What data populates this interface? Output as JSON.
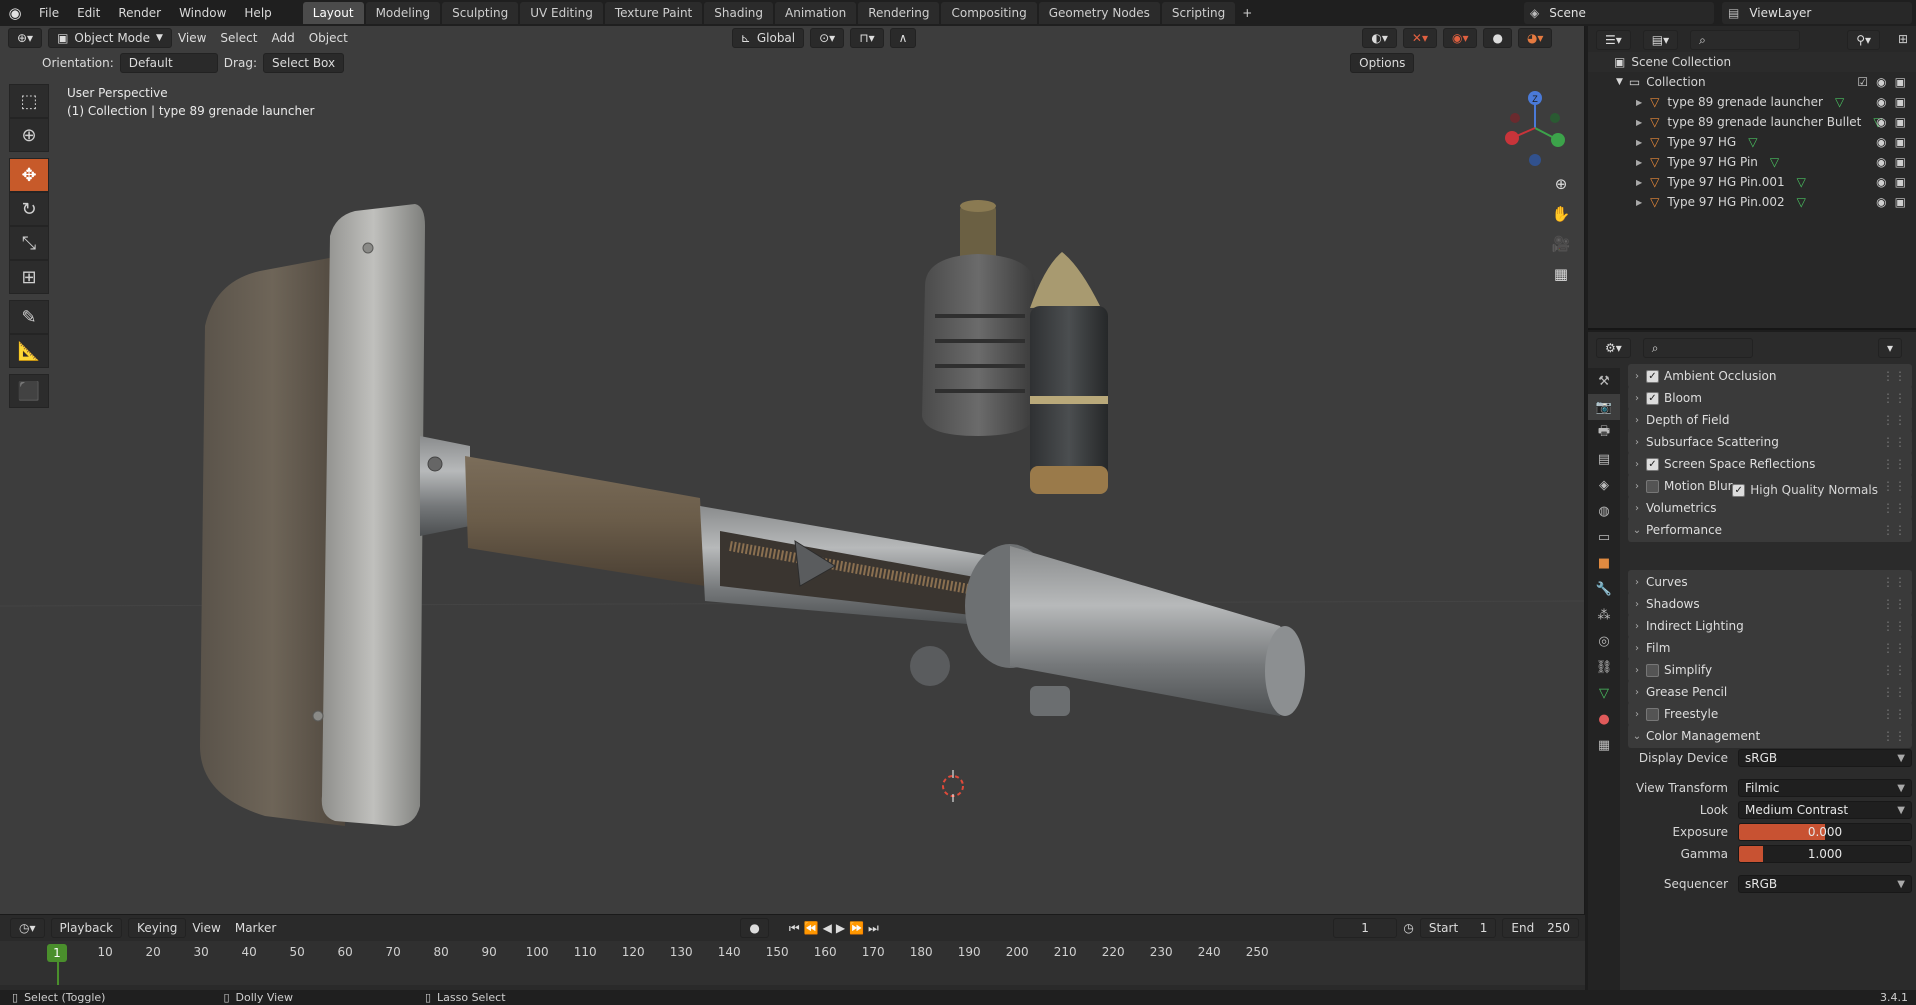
{
  "topbar": {
    "menus": [
      "File",
      "Edit",
      "Render",
      "Window",
      "Help"
    ],
    "workspaces": [
      "Layout",
      "Modeling",
      "Sculpting",
      "UV Editing",
      "Texture Paint",
      "Shading",
      "Animation",
      "Rendering",
      "Compositing",
      "Geometry Nodes",
      "Scripting"
    ],
    "active_workspace": "Layout",
    "scene_name": "Scene",
    "view_layer": "ViewLayer"
  },
  "viewport": {
    "mode": "Object Mode",
    "menus": [
      "View",
      "Select",
      "Add",
      "Object"
    ],
    "transform_orientation": "Global",
    "orientation_label": "Orientation:",
    "orientation_value": "Default",
    "drag_label": "Drag:",
    "drag_value": "Select Box",
    "options_label": "Options",
    "info_line1": "User Perspective",
    "info_line2": "(1) Collection | type 89 grenade launcher",
    "gizmo": {
      "x": "X",
      "y": "Y",
      "z": "Z"
    }
  },
  "outliner": {
    "root": "Scene Collection",
    "collection": "Collection",
    "objects": [
      "type 89 grenade launcher",
      "type 89 grenade launcher Bullet",
      "Type 97 HG",
      "Type 97 HG Pin",
      "Type 97 HG Pin.001",
      "Type 97 HG Pin.002"
    ]
  },
  "properties": {
    "panels": [
      {
        "label": "Ambient Occlusion",
        "checkbox": true,
        "checked": true
      },
      {
        "label": "Bloom",
        "checkbox": true,
        "checked": true
      },
      {
        "label": "Depth of Field",
        "checkbox": false
      },
      {
        "label": "Subsurface Scattering",
        "checkbox": false
      },
      {
        "label": "Screen Space Reflections",
        "checkbox": true,
        "checked": true
      },
      {
        "label": "Motion Blur",
        "checkbox": true,
        "checked": false
      },
      {
        "label": "Volumetrics",
        "checkbox": false
      },
      {
        "label": "Performance",
        "checkbox": false,
        "expanded": true
      },
      {
        "label": "Curves",
        "checkbox": false
      },
      {
        "label": "Shadows",
        "checkbox": false
      },
      {
        "label": "Indirect Lighting",
        "checkbox": false
      },
      {
        "label": "Film",
        "checkbox": false
      },
      {
        "label": "Simplify",
        "checkbox": true,
        "checked": false
      },
      {
        "label": "Grease Pencil",
        "checkbox": false
      },
      {
        "label": "Freestyle",
        "checkbox": true,
        "checked": false
      },
      {
        "label": "Color Management",
        "checkbox": false,
        "expanded": true
      }
    ],
    "high_quality_normals": "High Quality Normals",
    "color_management": {
      "display_device_label": "Display Device",
      "display_device": "sRGB",
      "view_transform_label": "View Transform",
      "view_transform": "Filmic",
      "look_label": "Look",
      "look": "Medium Contrast",
      "exposure_label": "Exposure",
      "exposure": "0.000",
      "gamma_label": "Gamma",
      "gamma": "1.000",
      "sequencer_label": "Sequencer",
      "sequencer": "sRGB"
    }
  },
  "timeline": {
    "menus": [
      "Playback",
      "Keying",
      "View",
      "Marker"
    ],
    "current_frame": "1",
    "start_label": "Start",
    "start": "1",
    "end_label": "End",
    "end": "250",
    "ticks": [
      "10",
      "20",
      "30",
      "40",
      "50",
      "60",
      "70",
      "80",
      "90",
      "100",
      "110",
      "120",
      "130",
      "140",
      "150",
      "160",
      "170",
      "180",
      "190",
      "200",
      "210",
      "220",
      "230",
      "240",
      "250"
    ],
    "playhead_label": "1"
  },
  "statusbar": {
    "left": "Select (Toggle)",
    "middle": "Dolly View",
    "right": "Lasso Select",
    "version": "3.4.1"
  },
  "colors": {
    "accent": "#c75a2a",
    "viewport_bg": "#3d3d3d",
    "frame_marker": "#4a8f2c"
  }
}
